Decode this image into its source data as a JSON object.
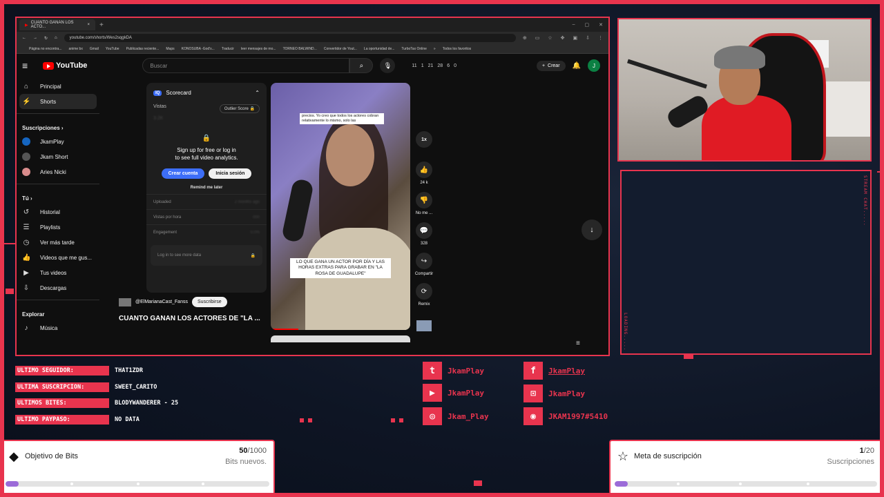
{
  "browser": {
    "tab_title": "CUANTO GANAN LOS ACTO...",
    "url": "youtube.com/shorts/Wes2sqgkDA",
    "bookmarks": [
      "Página no encontra...",
      "anime bx",
      "Gmail",
      "YouTube",
      "Publicadas reciente...",
      "Maps",
      "KONOSUBA -God's...",
      "Traducir",
      "leer mensajes de mo...",
      "TORNEO BALWIND...",
      "Convertidor de Yout...",
      "La oportunidad de...",
      "TurboTax Online",
      "»",
      "Todos los favoritos"
    ]
  },
  "youtube": {
    "logo_text": "YouTube",
    "search_placeholder": "Buscar",
    "ext_stats": [
      "11",
      "1",
      "21",
      "28",
      "6",
      "0"
    ],
    "create_label": "Crear",
    "avatar_letter": "J",
    "sidebar": {
      "main": [
        {
          "label": "Principal",
          "icon": "home-icon"
        },
        {
          "label": "Shorts",
          "icon": "shorts-icon"
        }
      ],
      "subs_heading": "Suscripciones",
      "subs": [
        {
          "label": "JkamPlay",
          "color": "#1565c0"
        },
        {
          "label": "Jkam Short",
          "color": "#555555"
        },
        {
          "label": "Aries Nicki",
          "color": "#d98c8c"
        }
      ],
      "you_heading": "Tú",
      "you": [
        {
          "label": "Historial",
          "icon": "history-icon"
        },
        {
          "label": "Playlists",
          "icon": "playlist-icon"
        },
        {
          "label": "Ver más tarde",
          "icon": "clock-icon"
        },
        {
          "label": "Videos que me gus...",
          "icon": "like-icon"
        },
        {
          "label": "Tus videos",
          "icon": "video-icon"
        },
        {
          "label": "Descargas",
          "icon": "download-icon"
        }
      ],
      "explore_heading": "Explorar",
      "explore": [
        {
          "label": "Música",
          "icon": "music-icon"
        }
      ]
    },
    "scorecard": {
      "badge": "IQ",
      "title": "Scorecard",
      "views_label": "Vistas",
      "views_value": "3.2K",
      "outlier_label": "Outlier Score",
      "cta_line1": "Sign up for free or log in",
      "cta_line2": "to see full video analytics.",
      "btn_create": "Crear cuenta",
      "btn_login": "Inicia sesión",
      "remind": "Remind me later",
      "stats": [
        {
          "label": "Uploaded",
          "value": "2 months ago"
        },
        {
          "label": "Vistas por hora",
          "value": "000"
        },
        {
          "label": "Engagement",
          "value": "0.0%"
        }
      ],
      "more": "Log in to see more data"
    },
    "short": {
      "channel": "@ElMarianaCast_Fanss",
      "subscribe": "Suscribirse",
      "title": "CUANTO GANAN LOS ACTORES DE \"LA ...",
      "caption_top": "precios. Yo creo que todos los actores cobran relativamente lo mismo, solo las",
      "caption_bottom": "LO QUE GANA UN ACTOR POR DÍA Y LAS HORAS EXTRAS PARA GRABAR EN \"LA ROSA DE GUADALUPE\"",
      "speed": "1x",
      "likes": "24 k",
      "dislike": "No me ...",
      "comments": "328",
      "share": "Compartir",
      "remix": "Remix"
    }
  },
  "stream": {
    "chat_label": "STREAM CHAT.....",
    "loading_label": "LOADING.....",
    "info": [
      {
        "label": "ULTIMO SEGUIDOR:",
        "value": "THAT1ZDR"
      },
      {
        "label": "ULTIMA SUSCRIPCION:",
        "value": "SWEET_CARITO"
      },
      {
        "label": "ULTIMOS BITES:",
        "value": "BLODYWANDERER - 25"
      },
      {
        "label": "ULTIMO PAYPASO:",
        "value": "NO DATA"
      }
    ],
    "social": [
      {
        "icon": "twitter-icon",
        "glyph": "t",
        "name": "JkamPlay"
      },
      {
        "icon": "youtube-icon",
        "glyph": "▶",
        "name": "JkamPlay"
      },
      {
        "icon": "instagram-icon",
        "glyph": "◎",
        "name": "Jkam_Play"
      },
      {
        "icon": "facebook-icon",
        "glyph": "f",
        "name": "JkamPlay"
      },
      {
        "icon": "twitch-icon",
        "glyph": "⊡",
        "name": "JkamPlay"
      },
      {
        "icon": "discord-icon",
        "glyph": "◉",
        "name": "JKAM1997#5410"
      }
    ],
    "goals": {
      "bits": {
        "title": "Objetivo de Bits",
        "current": "50",
        "total": "/1000",
        "sub": "Bits nuevos.",
        "progress": 0.05
      },
      "subs": {
        "title": "Meta de suscripción",
        "current": "1",
        "total": "/20",
        "sub": "Suscripciones",
        "progress": 0.05
      }
    },
    "accent": "#e8344e"
  }
}
